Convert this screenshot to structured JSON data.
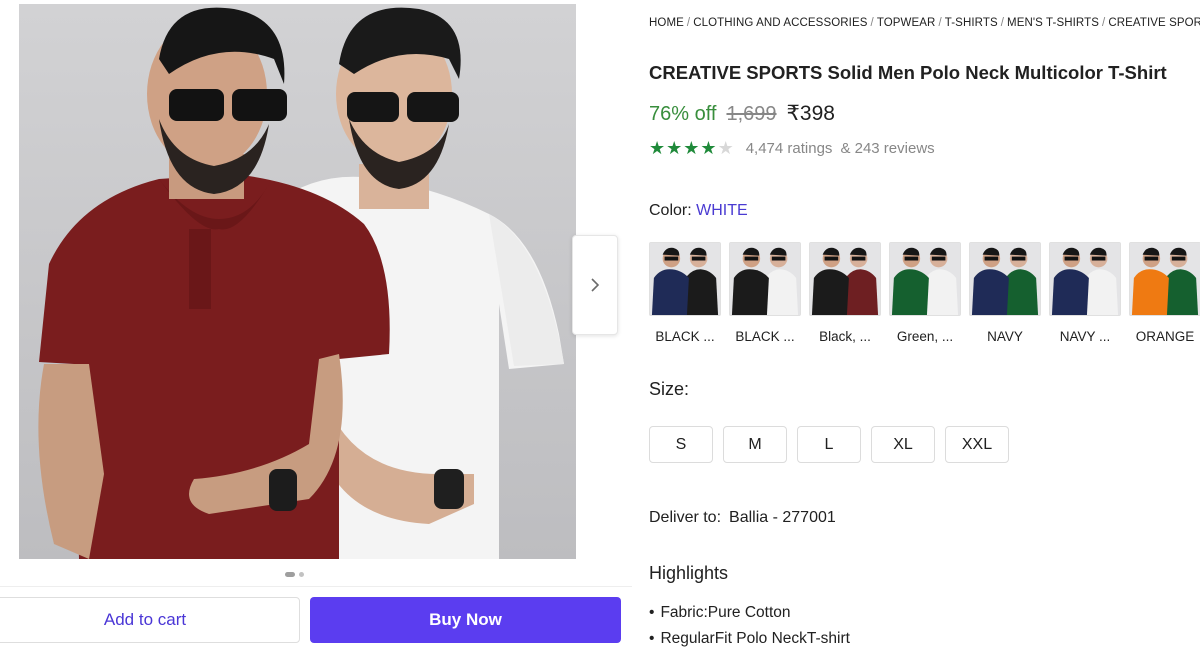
{
  "gallery": {
    "image_alt": "Two models wearing maroon and white polo t-shirts",
    "next_icon": "chevron-right-icon",
    "page_dots": 2,
    "active_dot": 0
  },
  "actions": {
    "add_to_cart": "Add to cart",
    "buy_now": "Buy Now",
    "accent_color": "#5b3df0"
  },
  "breadcrumb": [
    "HOME",
    "CLOTHING AND ACCESSORIES",
    "TOPWEAR",
    "T-SHIRTS",
    "MEN'S T-SHIRTS",
    "CREATIVE SPORTS"
  ],
  "product": {
    "title": "CREATIVE SPORTS Solid Men Polo Neck Multicolor T-Shirt",
    "discount": "76% off",
    "mrp": "1,699",
    "price": "₹398",
    "rating_stars": 4,
    "rating_max": 5,
    "ratings": "4,474 ratings",
    "reviews": "& 243 reviews"
  },
  "color": {
    "label": "Color:",
    "selected": "WHITE",
    "options": [
      {
        "label": "BLACK ...",
        "left": "#1f2b57",
        "right": "#1b1b1b"
      },
      {
        "label": "BLACK ...",
        "left": "#1b1b1b",
        "right": "#f2f2f2"
      },
      {
        "label": "Black, ...",
        "left": "#1b1b1b",
        "right": "#6e1f22"
      },
      {
        "label": "Green, ...",
        "left": "#15602f",
        "right": "#f2f2f2"
      },
      {
        "label": "NAVY",
        "left": "#1f2b57",
        "right": "#15602f"
      },
      {
        "label": "NAVY ...",
        "left": "#1f2b57",
        "right": "#f2f2f2"
      },
      {
        "label": "ORANGE",
        "left": "#ef7a12",
        "right": "#15602f"
      }
    ]
  },
  "size": {
    "label": "Size:",
    "options": [
      "S",
      "M",
      "L",
      "XL",
      "XXL"
    ]
  },
  "delivery": {
    "label": "Deliver to:",
    "location": "Ballia - 277001"
  },
  "highlights": {
    "title": "Highlights",
    "items": [
      "Fabric:Pure Cotton",
      "RegularFit Polo NeckT-shirt"
    ]
  }
}
